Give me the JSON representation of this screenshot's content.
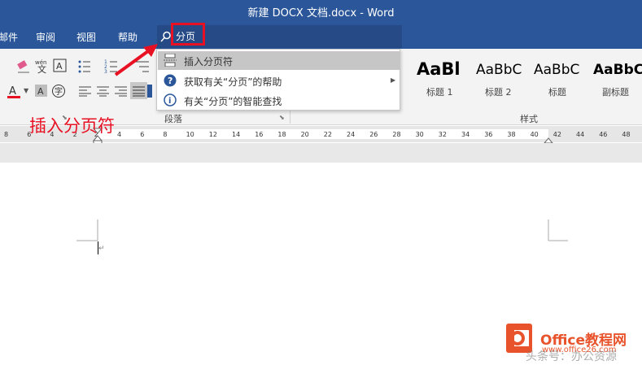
{
  "window": {
    "title": "新建 DOCX 文档.docx  -  Word"
  },
  "tabs": {
    "file_partial": "邮件",
    "review": "审阅",
    "view": "视图",
    "help": "帮助"
  },
  "tell_me": {
    "query": "分页"
  },
  "dropdown": {
    "items": [
      {
        "label": "插入分页符",
        "icon": "page-break-icon",
        "highlighted": true
      },
      {
        "label": "获取有关“分页”的帮助",
        "icon": "help-icon",
        "has_submenu": true
      },
      {
        "label": "有关“分页”的智能查找",
        "icon": "smart-lookup-icon"
      }
    ]
  },
  "ribbon": {
    "paragraph_group": "段落",
    "styles_group": "样式",
    "styles": [
      {
        "sample": "AaBl",
        "name": "标题 1"
      },
      {
        "sample": "AaBbC",
        "name": "标题 2"
      },
      {
        "sample": "AaBbC",
        "name": "标题"
      },
      {
        "sample": "AaBbC",
        "name": "副标题"
      }
    ]
  },
  "ruler": {
    "ticks": [
      "8",
      "6",
      "4",
      "2",
      "2",
      "4",
      "6",
      "8",
      "10",
      "12",
      "14",
      "16",
      "18",
      "20",
      "22",
      "24",
      "26",
      "28",
      "30",
      "32",
      "34",
      "36",
      "38",
      "40",
      "42",
      "44",
      "46",
      "48"
    ]
  },
  "annotation": {
    "text": "插入分页符"
  },
  "watermark": {
    "brand": "Office教程网",
    "url": "www.office26.com",
    "overlay": "头条号：办公资源"
  },
  "colors": {
    "word_blue": "#2b579a",
    "annotation_red": "#e81123",
    "menu_highlight": "#c6c6c6"
  }
}
